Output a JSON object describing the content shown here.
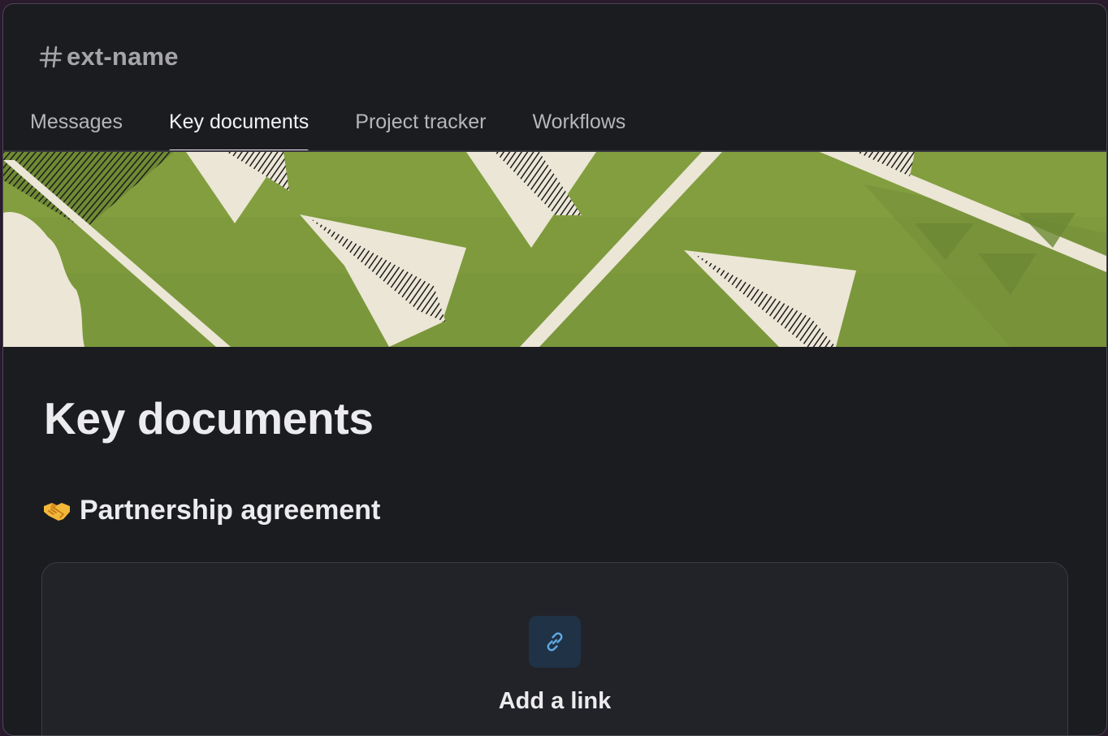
{
  "channel": {
    "prefix_icon": "hash-icon",
    "name": "ext-name"
  },
  "tabs": [
    {
      "label": "Messages",
      "active": false
    },
    {
      "label": "Key documents",
      "active": true
    },
    {
      "label": "Project tracker",
      "active": false
    },
    {
      "label": "Workflows",
      "active": false
    }
  ],
  "banner": {
    "icon": "paper-planes-illustration",
    "colors": {
      "background": "#7e9a3c",
      "plane": "#ebe6d6"
    }
  },
  "canvas": {
    "title": "Key documents",
    "section": {
      "icon": "handshake-emoji",
      "heading": "Partnership agreement"
    },
    "link_card": {
      "icon": "link-icon",
      "label": "Add a link"
    }
  },
  "colors": {
    "window_bg": "#1b1c20",
    "active_tab_underline": "#e8d8f2",
    "link_icon": "#5fa8e0"
  }
}
